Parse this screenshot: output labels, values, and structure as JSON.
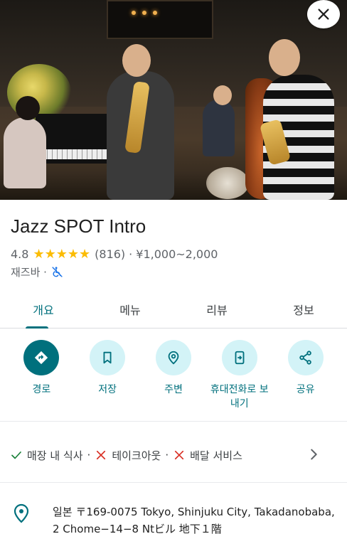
{
  "place": {
    "name": "Jazz SPOT Intro",
    "rating": "4.8",
    "stars": "★★★★★",
    "review_count": "(816)",
    "separator": "·",
    "price": "¥1,000~2,000",
    "category": "재즈바 ·",
    "accessibility_icon": "wheelchair-not-accessible-icon"
  },
  "tabs": [
    {
      "label": "개요",
      "active": true
    },
    {
      "label": "메뉴",
      "active": false
    },
    {
      "label": "리뷰",
      "active": false
    },
    {
      "label": "정보",
      "active": false
    }
  ],
  "actions": [
    {
      "label": "경로",
      "icon": "directions-icon"
    },
    {
      "label": "저장",
      "icon": "bookmark-icon"
    },
    {
      "label": "주변",
      "icon": "nearby-icon"
    },
    {
      "label": "휴대전화로 보내기",
      "icon": "send-to-phone-icon"
    },
    {
      "label": "공유",
      "icon": "share-icon"
    }
  ],
  "services": {
    "dine_in": "매장 내 식사",
    "takeout": "테이크아웃",
    "delivery": "배달 서비스",
    "dot": "·"
  },
  "address": {
    "text": "일본 〒169-0075 Tokyo, Shinjuku City, Takadanobaba, 2 Chome−14−8 Ntビル 地下１階"
  },
  "colors": {
    "accent": "#00707d",
    "accent_light": "#d3f3f7",
    "star": "#fbbc04",
    "check": "#188038",
    "cross": "#d93025",
    "accessibility": "#1a73e8"
  }
}
